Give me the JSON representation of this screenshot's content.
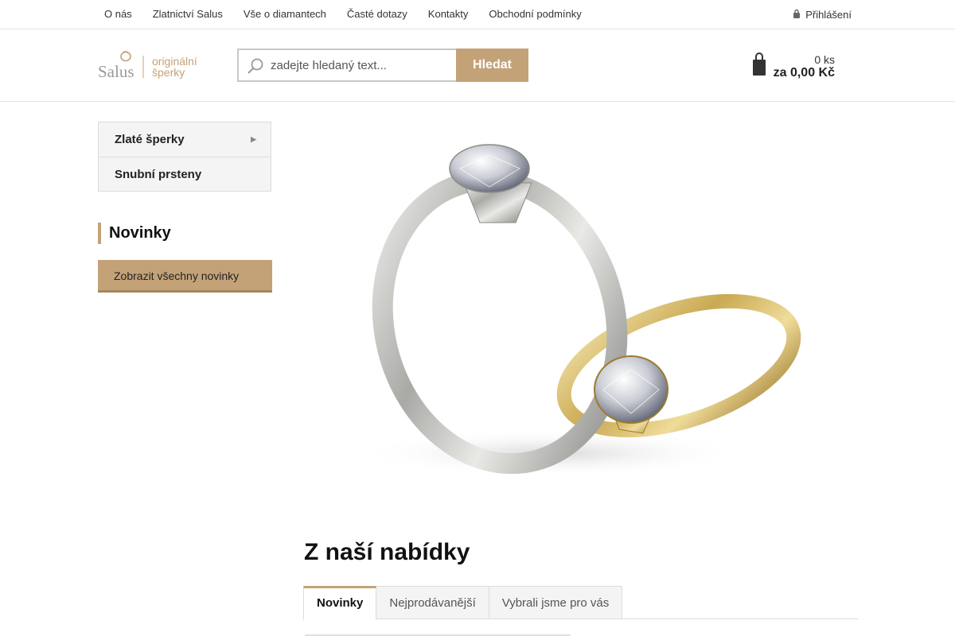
{
  "topnav": {
    "items": [
      "O nás",
      "Zlatnictví Salus",
      "Vše o diamantech",
      "Časté dotazy",
      "Kontakty",
      "Obchodní podmínky"
    ],
    "login_label": "Přihlášení"
  },
  "logo": {
    "brand": "Salus",
    "tagline_line1": "originální",
    "tagline_line2": "šperky"
  },
  "search": {
    "placeholder": "zadejte hledaný text...",
    "button_label": "Hledat"
  },
  "cart": {
    "quantity": "0 ks",
    "total": "za 0,00 Kč"
  },
  "sidebar": {
    "categories": [
      {
        "label": "Zlaté šperky",
        "has_submenu": true
      },
      {
        "label": "Snubní prsteny",
        "has_submenu": false
      }
    ],
    "news_heading": "Novinky",
    "news_button": "Zobrazit všechny novinky"
  },
  "main": {
    "section_title": "Z naší nabídky",
    "tabs": [
      "Novinky",
      "Nejprodávanější",
      "Vybrali jsme pro vás"
    ],
    "active_tab": "Novinky"
  },
  "colors": {
    "accent": "#c4a277",
    "accent_dark": "#a88858",
    "border": "#dcdcdc"
  }
}
